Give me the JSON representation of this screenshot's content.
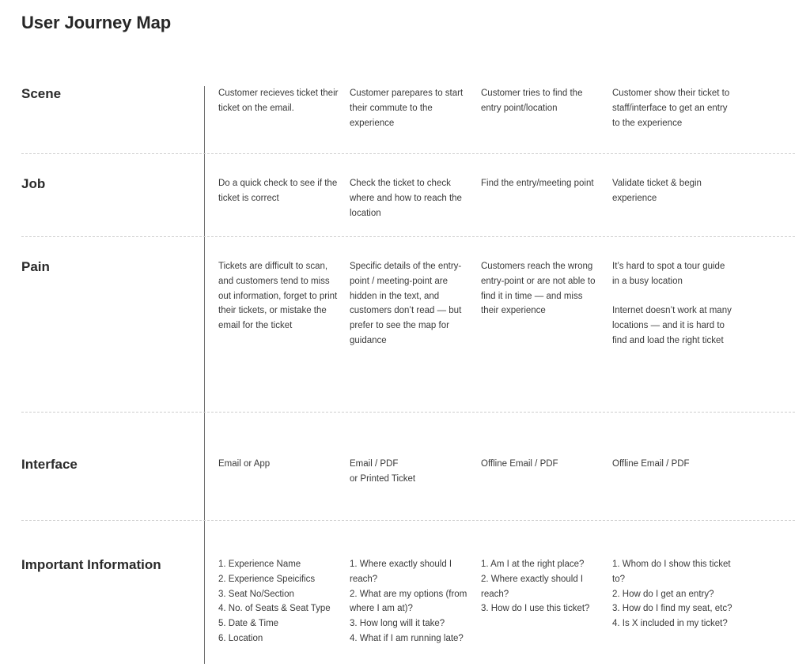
{
  "page": {
    "title": "User Journey Map"
  },
  "rows": [
    {
      "label": "Scene",
      "cells": [
        [
          "Customer recieves ticket their ticket on the email."
        ],
        [
          "Customer parepares to start their commute to the experience"
        ],
        [
          "Customer tries to find the entry point/location"
        ],
        [
          "Customer show their ticket to staff/interface to get an entry to the experience"
        ]
      ]
    },
    {
      "label": "Job",
      "cells": [
        [
          "Do a quick check to see if the ticket is correct"
        ],
        [
          "Check the ticket to check where and how to reach the location"
        ],
        [
          "Find the entry/meeting point"
        ],
        [
          "Validate ticket & begin experience"
        ]
      ]
    },
    {
      "label": "Pain",
      "cells": [
        [
          "Tickets are difficult to scan, and customers tend to miss out information, forget to print their tickets, or mistake the email for the ticket"
        ],
        [
          "Specific details of the entry-point / meeting-point are hidden in the text, and customers don’t read — but prefer to see the map for guidance"
        ],
        [
          "Customers reach the wrong entry-point or are not able to find it in time — and miss their experience"
        ],
        [
          "It’s hard to spot a tour guide in a busy location",
          "Internet doesn’t work at many locations — and it is hard to find and load the right ticket"
        ]
      ]
    },
    {
      "label": "Interface",
      "cells": [
        [
          "Email or App"
        ],
        [
          "Email / PDF",
          "or Printed Ticket"
        ],
        [
          "Offline Email / PDF"
        ],
        [
          "Offline Email / PDF"
        ]
      ]
    },
    {
      "label": "Important Information",
      "cells": [
        [
          "1. Experience Name",
          "2. Experience Speicifics",
          "3. Seat No/Section",
          "4. No. of Seats & Seat Type",
          "5. Date & Time",
          "6. Location"
        ],
        [
          "1. Where exactly should I reach?",
          "2. What are my options (from where I am at)?",
          "3. How long will it take?",
          "4. What if I am running late?"
        ],
        [
          "1. Am I at the right place?",
          "2. Where exactly should I reach?",
          "3. How do I use this ticket?"
        ],
        [
          "1. Whom do I show this ticket to?",
          "2. How do I get an entry?",
          "3. How do I find my seat, etc?",
          "4. Is X included in my ticket?"
        ]
      ]
    }
  ]
}
